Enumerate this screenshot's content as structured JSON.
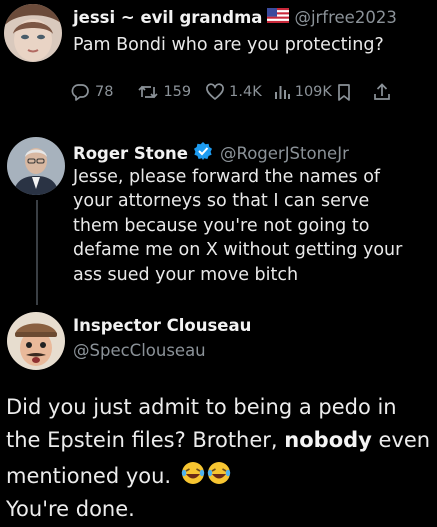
{
  "tweet1": {
    "name": "jessi ~ evil grandma",
    "handle": "@jrfree2023",
    "text": "Pam Bondi who are you protecting?",
    "replies": "78",
    "reposts": "159",
    "likes": "1.4K",
    "views": "109K"
  },
  "tweet2": {
    "name": "Roger Stone",
    "handle": "@RogerJStoneJr",
    "lines": [
      "Jesse, please forward the names of",
      "your attorneys so that I can serve",
      "them because you're not going to",
      "defame me on X without getting your",
      "ass sued your move bitch"
    ]
  },
  "tweet3": {
    "name": "Inspector Clouseau",
    "handle": "@SpecClouseau",
    "line1": "Did you just admit to being a pedo in",
    "line2_pre": "the Epstein files? Brother, ",
    "line2_bold": "nobody",
    "line2_post": " even",
    "line3": "mentioned you.",
    "line4": "You're done."
  },
  "colors": {
    "background": "#000000",
    "text": "#e7e9ea",
    "muted": "#8b9298",
    "verified": "#1d9bf0"
  },
  "icons": [
    "us-flag-icon",
    "reply-icon",
    "repost-icon",
    "like-icon",
    "views-icon",
    "bookmark-icon",
    "share-icon",
    "verified-badge-icon",
    "laughing-emoji-icon"
  ]
}
